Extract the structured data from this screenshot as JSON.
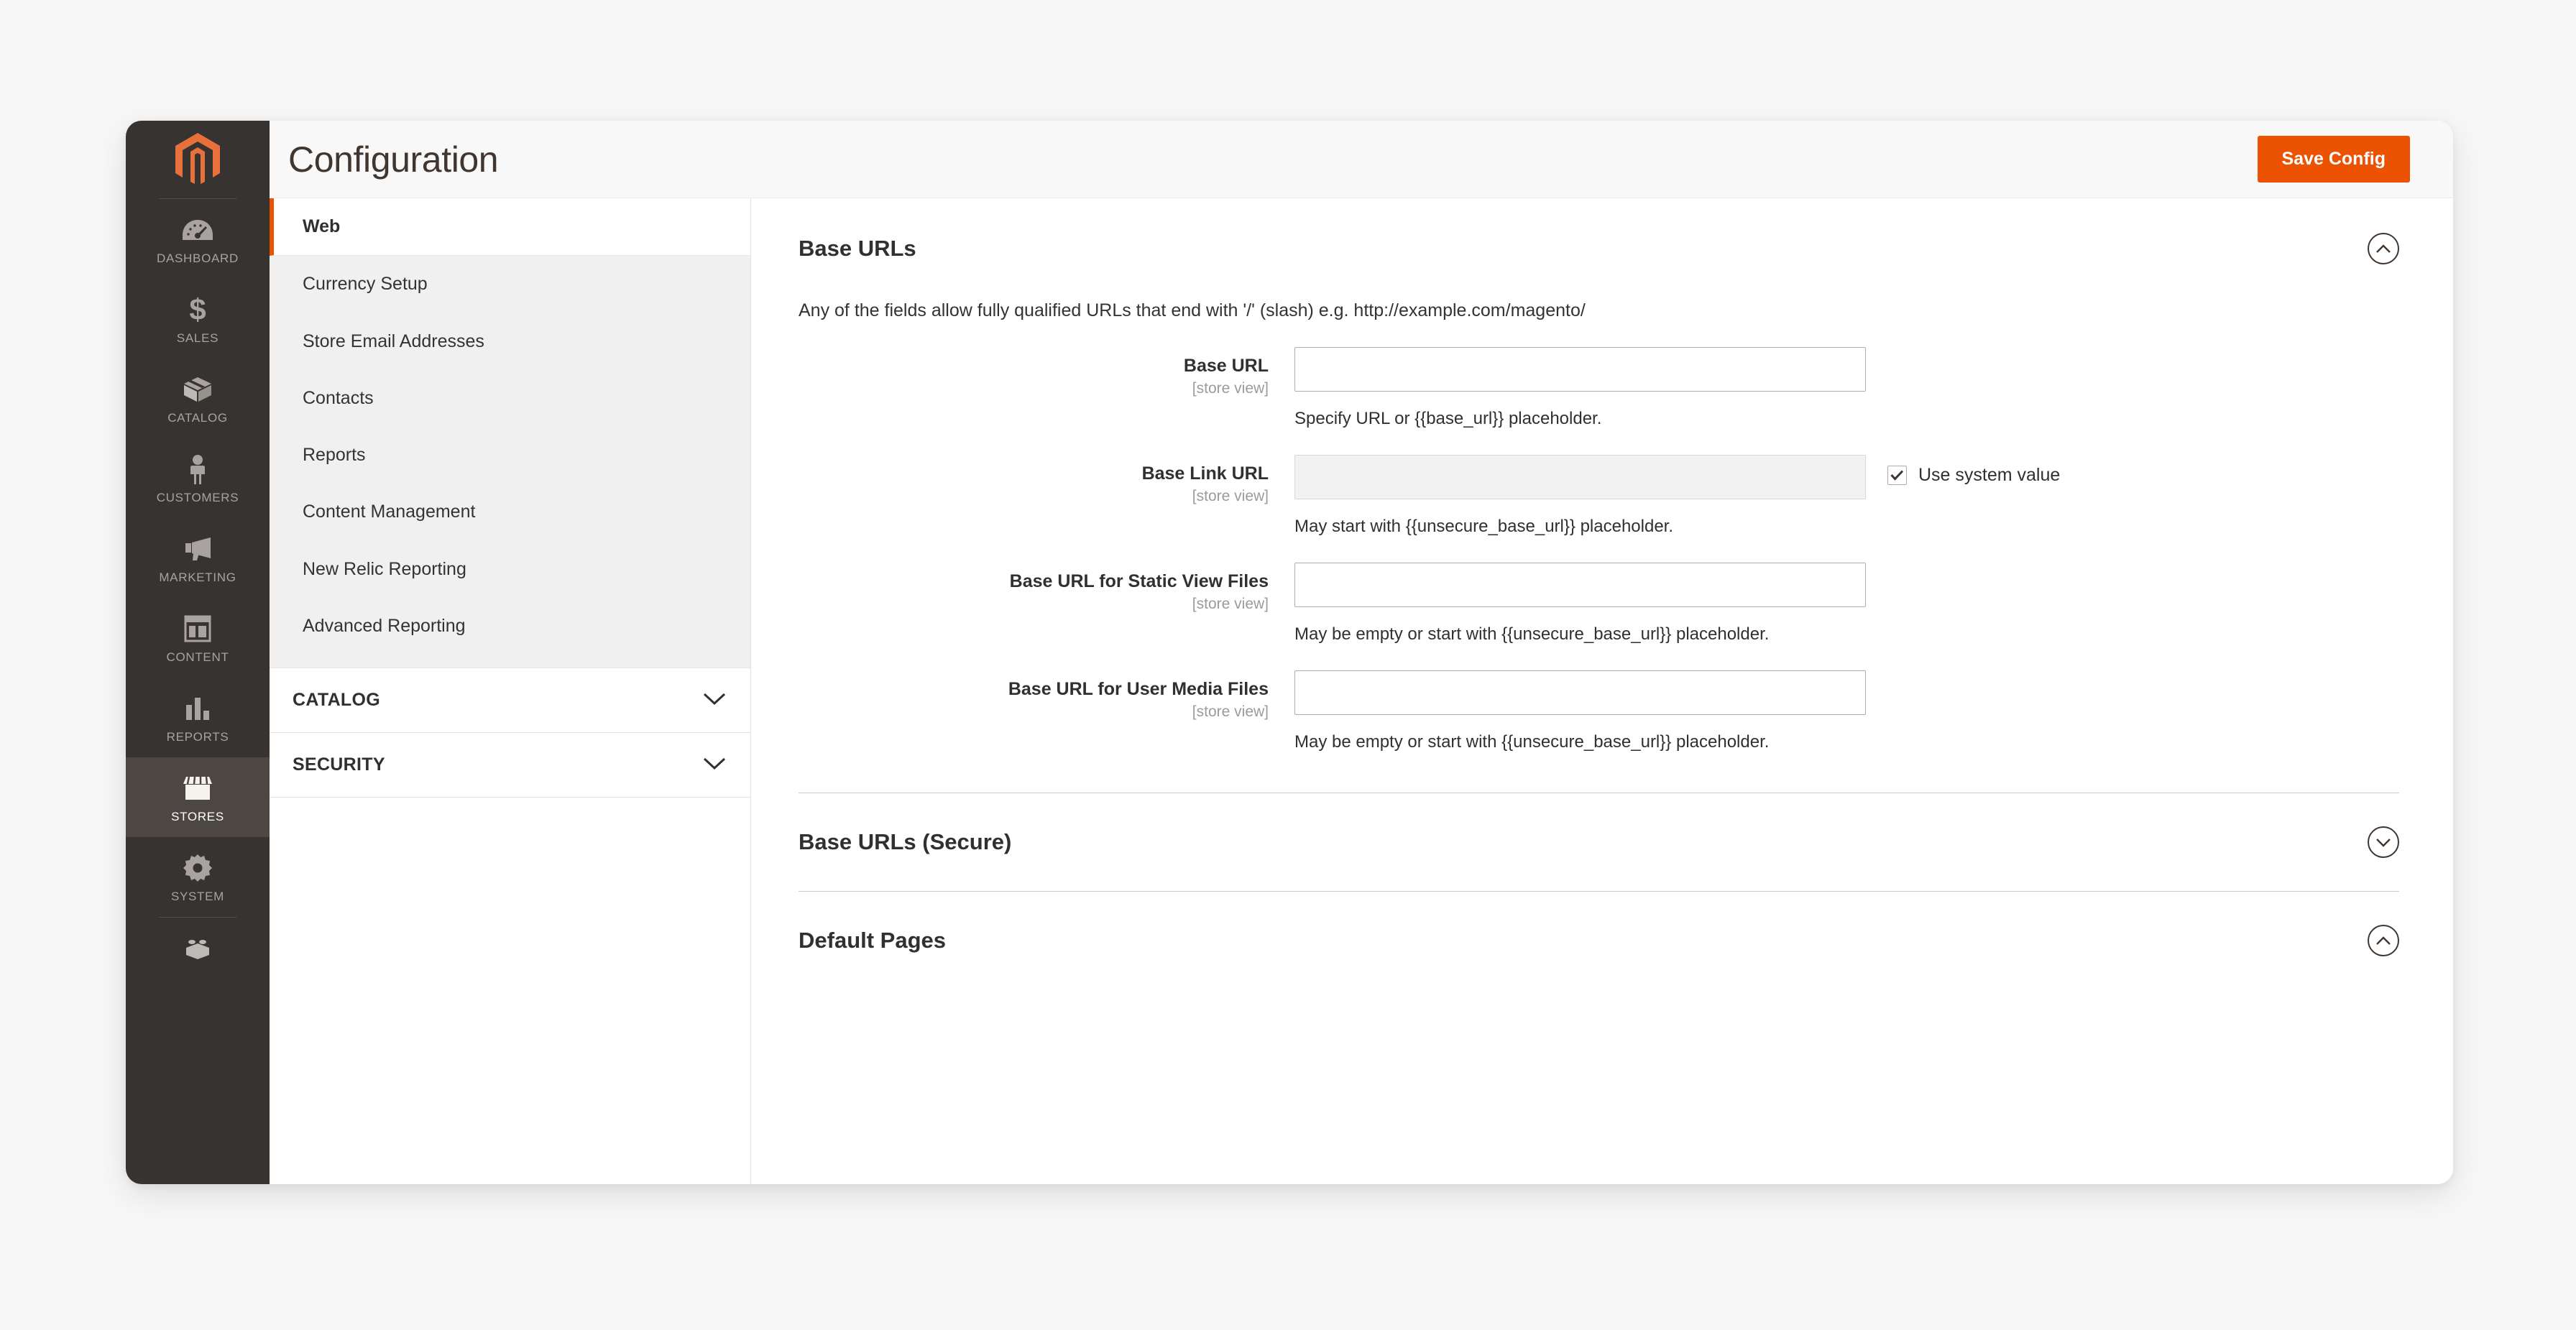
{
  "header": {
    "title": "Configuration",
    "save_label": "Save Config"
  },
  "sidebar": {
    "items": [
      {
        "label": "DASHBOARD",
        "icon": "dashboard-gauge-icon",
        "active": false
      },
      {
        "label": "SALES",
        "icon": "dollar-icon",
        "active": false
      },
      {
        "label": "CATALOG",
        "icon": "box-icon",
        "active": false
      },
      {
        "label": "CUSTOMERS",
        "icon": "person-icon",
        "active": false
      },
      {
        "label": "MARKETING",
        "icon": "megaphone-icon",
        "active": false
      },
      {
        "label": "CONTENT",
        "icon": "layout-icon",
        "active": false
      },
      {
        "label": "REPORTS",
        "icon": "bar-chart-icon",
        "active": false
      },
      {
        "label": "STORES",
        "icon": "storefront-icon",
        "active": true
      },
      {
        "label": "SYSTEM",
        "icon": "gear-icon",
        "active": false
      }
    ]
  },
  "config_menu": {
    "items": [
      {
        "label": "Web",
        "active": true
      },
      {
        "label": "Currency Setup",
        "active": false
      },
      {
        "label": "Store Email Addresses",
        "active": false
      },
      {
        "label": "Contacts",
        "active": false
      },
      {
        "label": "Reports",
        "active": false
      },
      {
        "label": "Content Management",
        "active": false
      },
      {
        "label": "New Relic Reporting",
        "active": false
      },
      {
        "label": "Advanced Reporting",
        "active": false
      }
    ],
    "sections": [
      {
        "label": "CATALOG",
        "expanded": false
      },
      {
        "label": "SECURITY",
        "expanded": false
      }
    ]
  },
  "content": {
    "base_urls": {
      "title": "Base URLs",
      "expanded": true,
      "note": "Any of the fields allow fully qualified URLs that end with '/' (slash) e.g. http://example.com/magento/",
      "fields": [
        {
          "label": "Base URL",
          "scope": "[store view]",
          "value": "",
          "comment": "Specify URL or {{base_url}} placeholder.",
          "disabled": false,
          "has_system_checkbox": false,
          "system_checked": false
        },
        {
          "label": "Base Link URL",
          "scope": "[store view]",
          "value": "",
          "comment": "May start with {{unsecure_base_url}} placeholder.",
          "disabled": true,
          "has_system_checkbox": true,
          "system_checked": true,
          "system_label": "Use system value"
        },
        {
          "label": "Base URL for Static View Files",
          "scope": "[store view]",
          "value": "",
          "comment": "May be empty or start with {{unsecure_base_url}} placeholder.",
          "disabled": false,
          "has_system_checkbox": false,
          "system_checked": false
        },
        {
          "label": "Base URL for User Media Files",
          "scope": "[store view]",
          "value": "",
          "comment": "May be empty or start with {{unsecure_base_url}} placeholder.",
          "disabled": false,
          "has_system_checkbox": false,
          "system_checked": false
        }
      ]
    },
    "base_urls_secure": {
      "title": "Base URLs (Secure)",
      "expanded": false
    },
    "default_pages": {
      "title": "Default Pages",
      "expanded": true
    }
  },
  "colors": {
    "accent_orange": "#eb5202",
    "nav_background": "#373330",
    "nav_active": "#4c4743",
    "page_background": "#f7f7f7"
  }
}
